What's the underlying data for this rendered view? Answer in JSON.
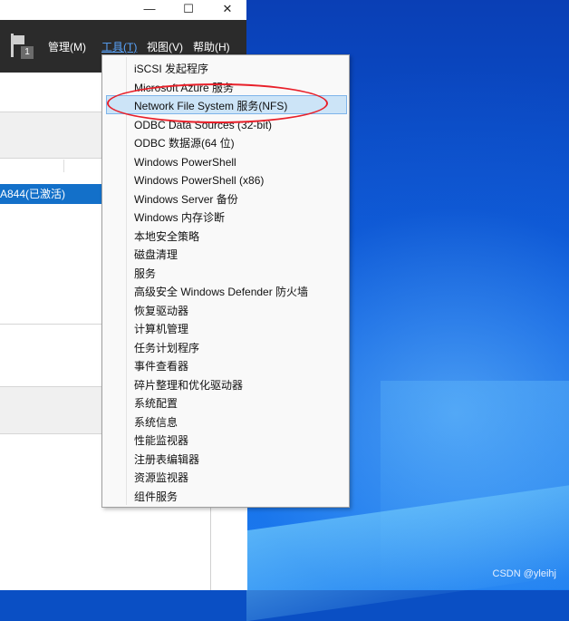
{
  "window": {
    "controls": {
      "minimize": "—",
      "maximize": "☐",
      "close": "✕"
    },
    "flag_badge": "1",
    "menus": [
      {
        "label": "管理(M)",
        "active": false
      },
      {
        "label": "工具(T)",
        "active": true
      },
      {
        "label": "视图(V)",
        "active": false
      },
      {
        "label": "帮助(H)",
        "active": false
      }
    ],
    "selected_server": "A844(已激活)"
  },
  "tools_menu": {
    "items": [
      "iSCSI 发起程序",
      "Microsoft Azure 服务",
      "Network File System 服务(NFS)",
      "ODBC Data Sources (32-bit)",
      "ODBC 数据源(64 位)",
      "Windows PowerShell",
      "Windows PowerShell (x86)",
      "Windows Server 备份",
      "Windows 内存诊断",
      "本地安全策略",
      "磁盘清理",
      "服务",
      "高级安全 Windows Defender 防火墙",
      "恢复驱动器",
      "计算机管理",
      "任务计划程序",
      "事件查看器",
      "碎片整理和优化驱动器",
      "系统配置",
      "系统信息",
      "性能监视器",
      "注册表编辑器",
      "资源监视器",
      "组件服务"
    ],
    "highlighted_index": 2
  },
  "colors": {
    "selection": "#1370c9",
    "menu_highlight": "#cce4f7",
    "annotation": "#e8202a",
    "menubar": "#2b2b2b"
  },
  "watermark": "CSDN @yleihj"
}
